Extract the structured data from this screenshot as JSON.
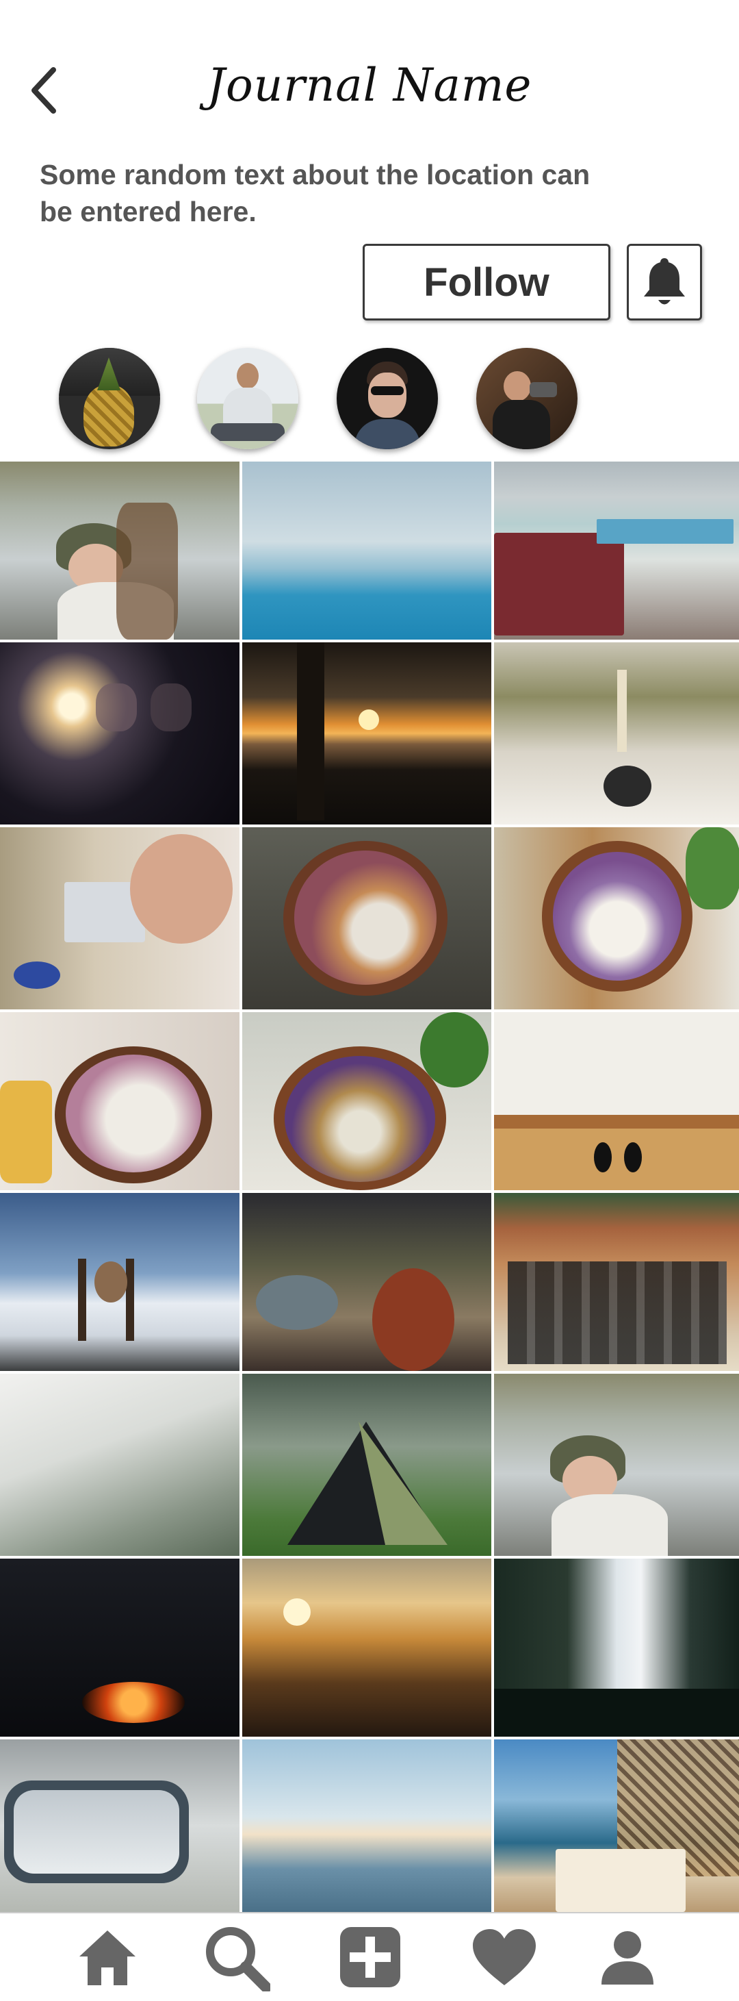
{
  "header": {
    "title": "Journal Name",
    "description": "Some random text about the location can be entered here.",
    "follow_label": "Follow"
  },
  "icons": {
    "back": "chevron-left-icon",
    "bell": "bell-icon",
    "tabs": [
      "home-icon",
      "search-icon",
      "add-icon",
      "heart-icon",
      "profile-icon"
    ]
  },
  "colors": {
    "text_dark": "#111111",
    "text_gray": "#555555",
    "icon_gray": "#666666",
    "border": "#3a3a3a"
  }
}
